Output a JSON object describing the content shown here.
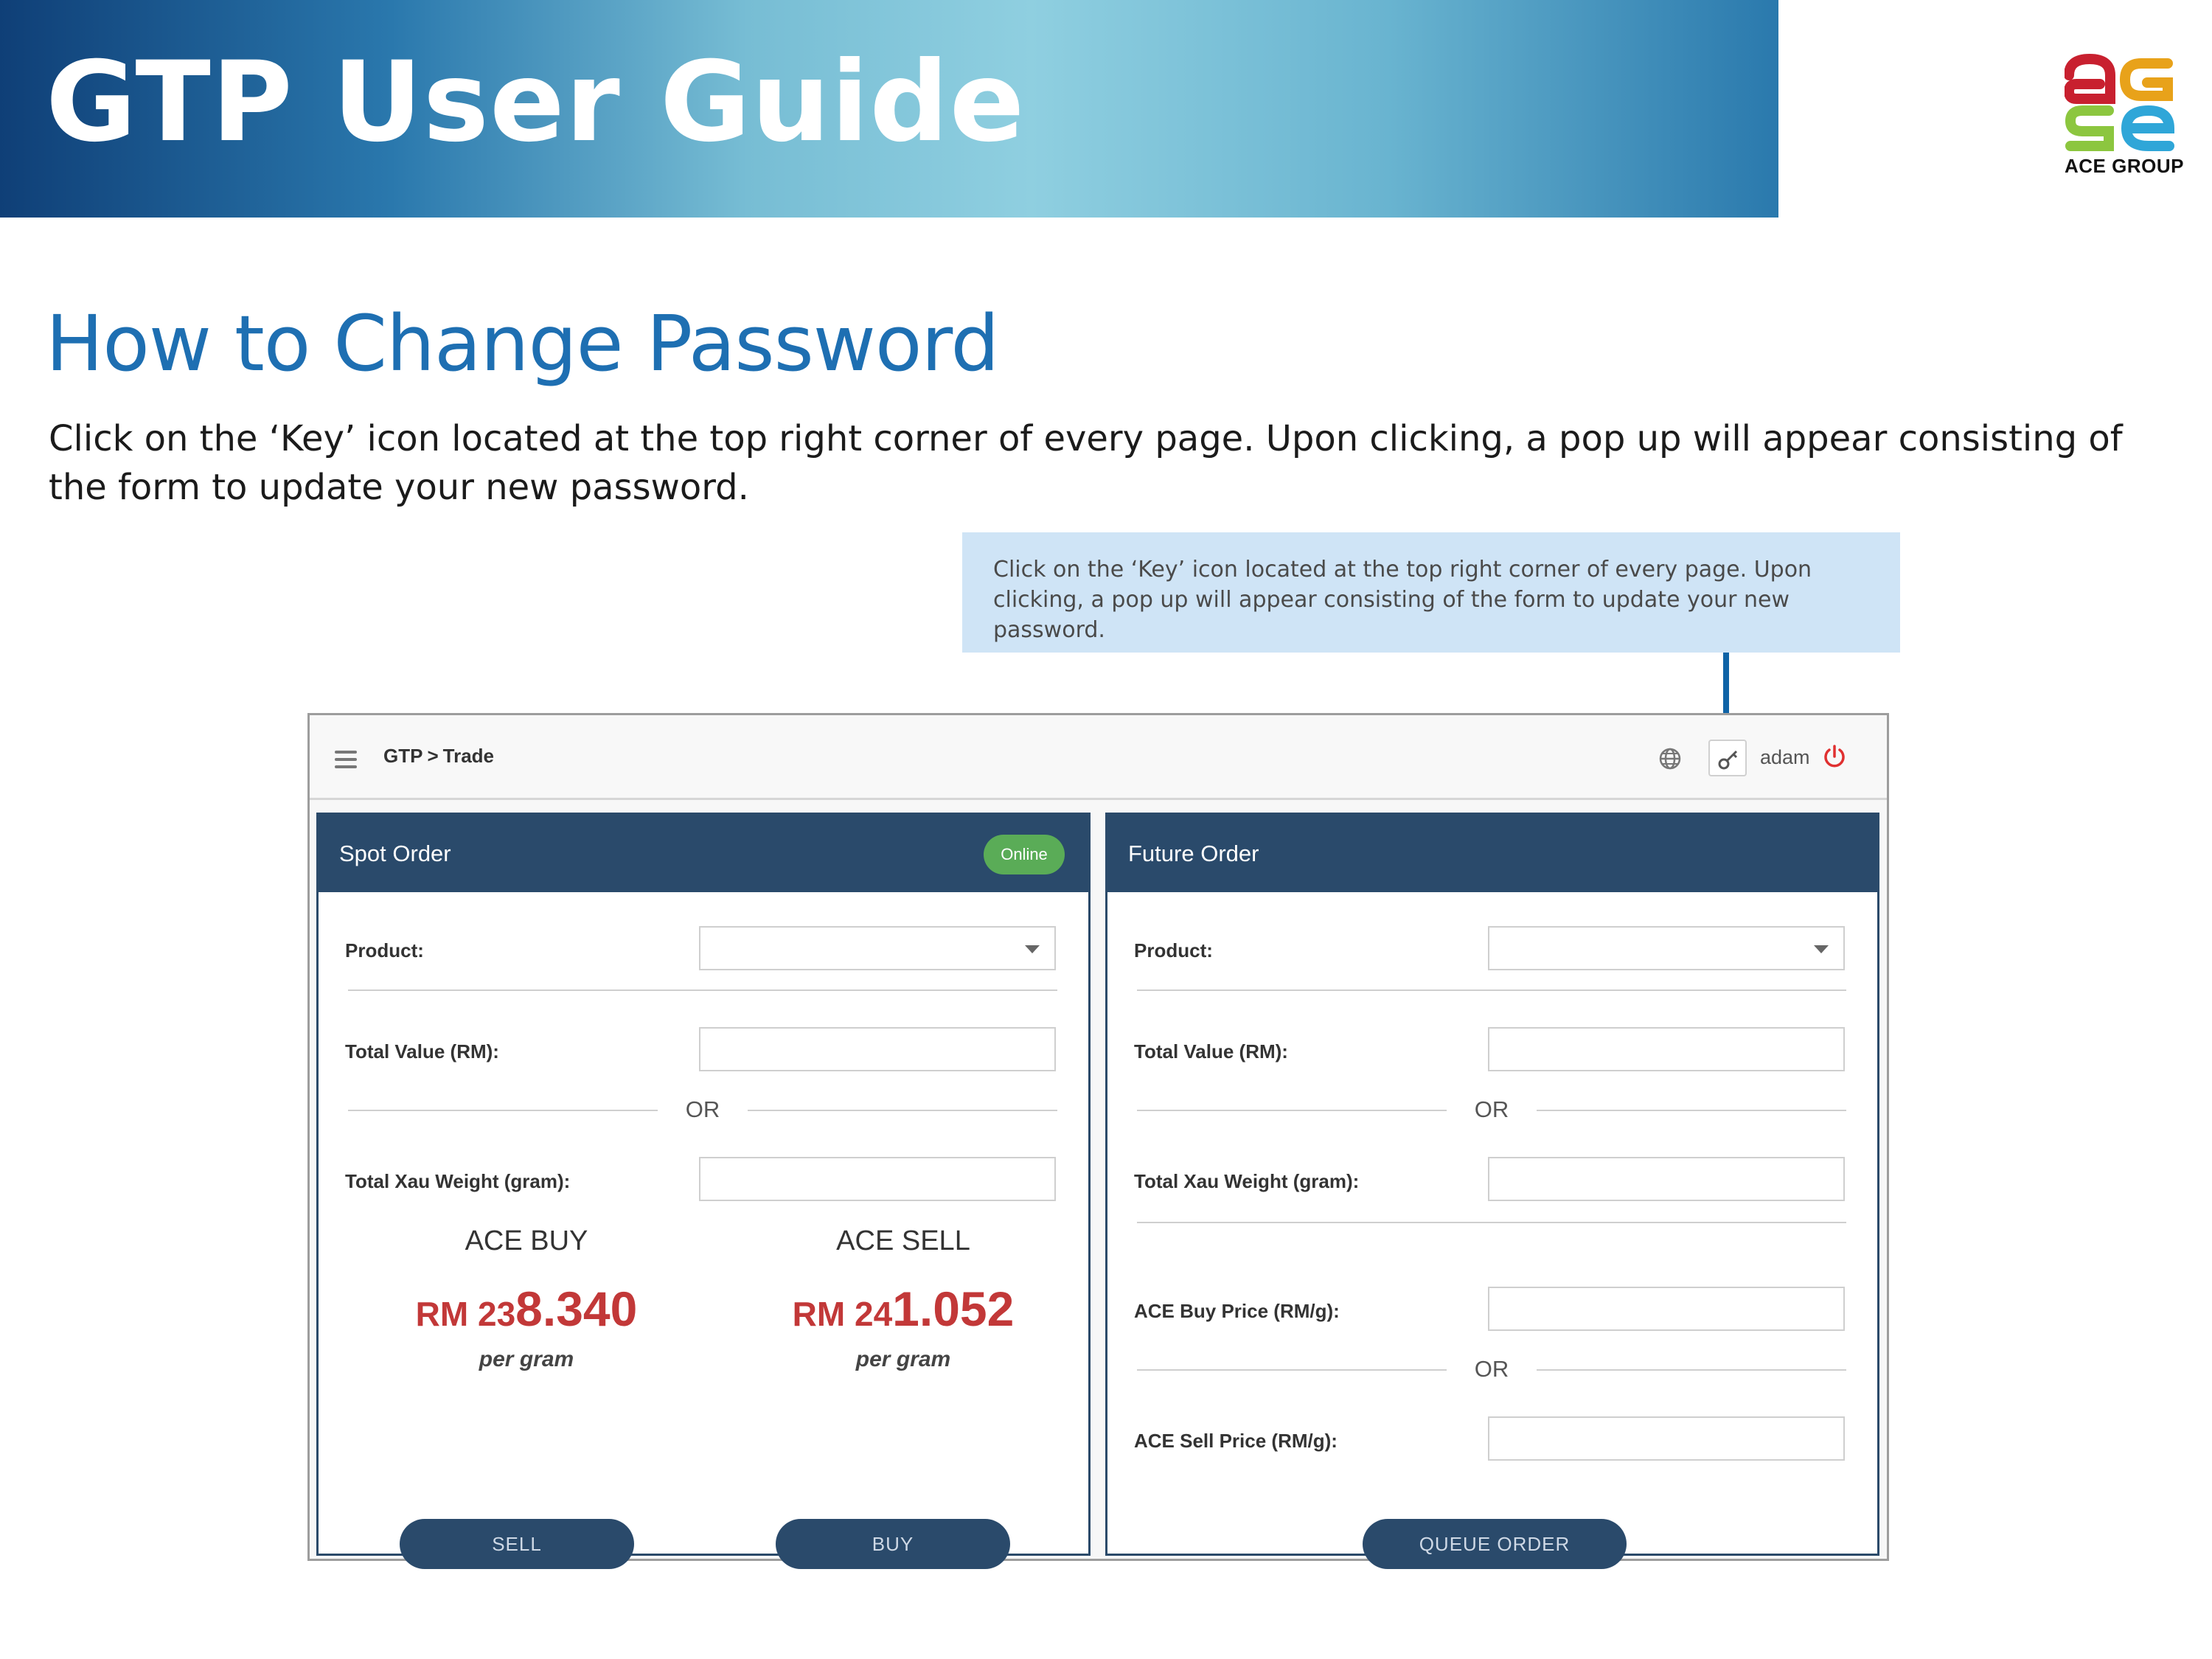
{
  "banner": {
    "title": "GTP User Guide"
  },
  "logo": {
    "text": "ACE GROUP",
    "colors": [
      "#c8202f",
      "#e8a21a",
      "#8cc63f",
      "#2fa6d8"
    ]
  },
  "page": {
    "heading": "How to Change Password",
    "intro": "Click on the ‘Key’ icon located at the top right corner of every page. Upon clicking, a pop up will appear consisting of the form to update your new password."
  },
  "callout": {
    "text": "Click on the ‘Key’ icon located at the top right corner of every page. Upon clicking, a pop up will appear consisting of the form to update your new password."
  },
  "app": {
    "breadcrumb": {
      "root": "GTP",
      "separator": ">",
      "current": "Trade"
    },
    "icons": {
      "menu": "hamburger-icon",
      "language": "globe-icon",
      "password": "key-icon",
      "logout": "power-icon"
    },
    "user": "adam",
    "spot": {
      "title": "Spot Order",
      "status": "Online",
      "product_label": "Product:",
      "total_value_label": "Total Value (RM):",
      "or": "OR",
      "weight_label": "Total Xau Weight (gram):",
      "ace_buy": {
        "label": "ACE BUY",
        "currency": "RM 23",
        "value": "8.340",
        "unit": "per gram"
      },
      "ace_sell": {
        "label": "ACE SELL",
        "currency": "RM 24",
        "value": "1.052",
        "unit": "per gram"
      },
      "sell_button": "SELL",
      "buy_button": "BUY"
    },
    "future": {
      "title": "Future Order",
      "product_label": "Product:",
      "total_value_label": "Total Value (RM):",
      "or": "OR",
      "weight_label": "Total Xau Weight (gram):",
      "buy_price_label": "ACE Buy Price (RM/g):",
      "or2": "OR",
      "sell_price_label": "ACE Sell Price (RM/g):",
      "queue_button": "QUEUE ORDER"
    }
  },
  "colors": {
    "heading": "#1e6fb2",
    "panel_header": "#2a4a6b",
    "price": "#c23838",
    "online": "#5aac57",
    "callout_bg": "#cfe4f6",
    "connector": "#0e63a6",
    "power": "#e03030"
  }
}
